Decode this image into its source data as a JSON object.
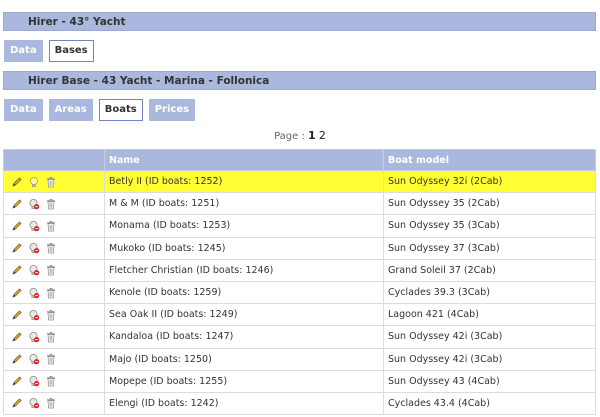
{
  "header": {
    "title": "Hirer - 43° Yacht"
  },
  "top_tabs": [
    {
      "label": "Data",
      "active": false
    },
    {
      "label": "Bases",
      "active": true
    }
  ],
  "base": {
    "title": "Hirer Base - 43 Yacht - Marina - Follonica"
  },
  "base_tabs": [
    {
      "label": "Data",
      "active": false
    },
    {
      "label": "Areas",
      "active": false
    },
    {
      "label": "Boats",
      "active": true
    },
    {
      "label": "Prices",
      "active": false
    }
  ],
  "pager": {
    "label": "Page :",
    "current": "1",
    "other": "2"
  },
  "table": {
    "columns": [
      "",
      "Name",
      "Boat model"
    ],
    "rows": [
      {
        "name": "Betly II (ID boats: 1252)",
        "model": "Sun Odyssey 32i (2Cab)",
        "highlight": true,
        "status": "lightbulb-icon"
      },
      {
        "name": "M & M (ID boats: 1251)",
        "model": "Sun Odyssey 35 (2Cab)",
        "status": "bulb-off-icon"
      },
      {
        "name": "Monama (ID boats: 1253)",
        "model": "Sun Odyssey 35 (3Cab)",
        "status": "bulb-off-icon"
      },
      {
        "name": "Mukoko (ID boats: 1245)",
        "model": "Sun Odyssey 37 (3Cab)",
        "status": "bulb-off-icon"
      },
      {
        "name": "Fletcher Christian (ID boats: 1246)",
        "model": "Grand Soleil 37 (2Cab)",
        "status": "bulb-off-icon"
      },
      {
        "name": "Kenole (ID boats: 1259)",
        "model": "Cyclades 39.3 (3Cab)",
        "status": "bulb-off-icon"
      },
      {
        "name": "Sea Oak II (ID boats: 1249)",
        "model": "Lagoon 421 (4Cab)",
        "status": "bulb-off-icon"
      },
      {
        "name": "Kandaloa (ID boats: 1247)",
        "model": "Sun Odyssey 42i (3Cab)",
        "status": "bulb-off-icon"
      },
      {
        "name": "Majo (ID boats: 1250)",
        "model": "Sun Odyssey 42i (3Cab)",
        "status": "bulb-off-icon"
      },
      {
        "name": "Mopepe (ID boats: 1255)",
        "model": "Sun Odyssey 43 (4Cab)",
        "status": "bulb-off-icon"
      },
      {
        "name": "Elengi (ID boats: 1242)",
        "model": "Cyclades 43.4 (4Cab)",
        "status": "bulb-off-icon"
      }
    ]
  },
  "colors": {
    "bar": "#a9b8dc",
    "highlight": "#ffff33",
    "active_tab_border": "#6f86c4"
  }
}
